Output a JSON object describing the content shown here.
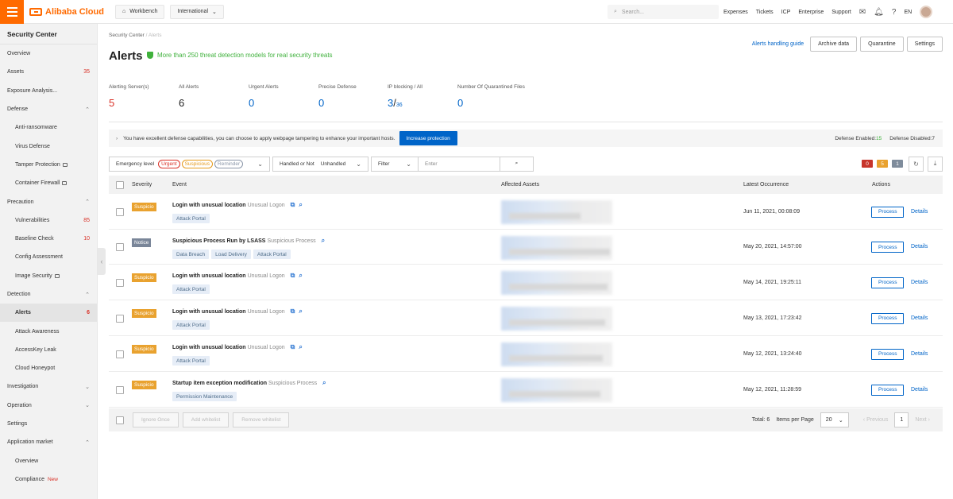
{
  "topbar": {
    "brand": "Alibaba Cloud",
    "workbench": "Workbench",
    "region": "International",
    "search_placeholder": "Search...",
    "links": [
      "Expenses",
      "Tickets",
      "ICP",
      "Enterprise",
      "Support"
    ],
    "lang": "EN"
  },
  "sidebar": {
    "title": "Security Center",
    "items": [
      {
        "label": "Overview",
        "count": "",
        "type": "top"
      },
      {
        "label": "Assets",
        "count": "35",
        "type": "top"
      },
      {
        "label": "Exposure Analysis...",
        "count": "",
        "type": "top"
      },
      {
        "label": "Defense",
        "count": "",
        "type": "group",
        "expanded": true
      },
      {
        "label": "Anti-ransomware",
        "count": "",
        "type": "sub"
      },
      {
        "label": "Virus Defense",
        "count": "",
        "type": "sub"
      },
      {
        "label": "Tamper Protection",
        "count": "",
        "type": "sub",
        "lock": true
      },
      {
        "label": "Container Firewall",
        "count": "",
        "type": "sub",
        "lock": true
      },
      {
        "label": "Precaution",
        "count": "",
        "type": "group",
        "expanded": true
      },
      {
        "label": "Vulnerabilities",
        "count": "85",
        "type": "sub"
      },
      {
        "label": "Baseline Check",
        "count": "10",
        "type": "sub"
      },
      {
        "label": "Config Assessment",
        "count": "",
        "type": "sub"
      },
      {
        "label": "Image Security",
        "count": "",
        "type": "sub",
        "lock": true
      },
      {
        "label": "Detection",
        "count": "",
        "type": "group",
        "expanded": true
      },
      {
        "label": "Alerts",
        "count": "6",
        "type": "sub",
        "active": true
      },
      {
        "label": "Attack Awareness",
        "count": "",
        "type": "sub"
      },
      {
        "label": "AccessKey Leak",
        "count": "",
        "type": "sub"
      },
      {
        "label": "Cloud Honeypot",
        "count": "",
        "type": "sub"
      },
      {
        "label": "Investigation",
        "count": "",
        "type": "group",
        "expanded": false
      },
      {
        "label": "Operation",
        "count": "",
        "type": "group",
        "expanded": false
      },
      {
        "label": "Settings",
        "count": "",
        "type": "top"
      },
      {
        "label": "Application market",
        "count": "",
        "type": "group",
        "expanded": true
      },
      {
        "label": "Overview",
        "count": "",
        "type": "sub"
      },
      {
        "label": "Compliance",
        "count": "",
        "type": "sub",
        "new": "New"
      }
    ]
  },
  "page": {
    "breadcrumb": [
      "Security Center",
      "Alerts"
    ],
    "title": "Alerts",
    "slogan": "More than 250 threat detection models for real security threats",
    "guide": "Alerts handling guide",
    "buttons": [
      "Archive data",
      "Quarantine",
      "Settings"
    ]
  },
  "stats": [
    {
      "label": "Alerting Server(s)",
      "value": "5",
      "color": "#d93026"
    },
    {
      "label": "All Alerts",
      "value": "6",
      "color": "#222222"
    },
    {
      "label": "Urgent Alerts",
      "value": "0",
      "color": "#0064c8"
    },
    {
      "label": "Precise Defense",
      "value": "0",
      "color": "#0064c8"
    },
    {
      "label": "IP blocking / All",
      "value": "3",
      "total": "36",
      "color": "#0064c8"
    },
    {
      "label": "Number Of Quarantined Files",
      "value": "0",
      "color": "#0064c8"
    }
  ],
  "notice": {
    "text": "You have excellent defense capabilities, you can choose to apply webpage tampering to enhance your important hosts.",
    "button": "Increase protection",
    "enabled_label": "Defense Enabled:",
    "enabled_value": "15",
    "disabled_label": "Defense Disabled:",
    "disabled_value": "7"
  },
  "filters": {
    "emergency_label": "Emergency level",
    "levels": [
      {
        "label": "Urgent",
        "color": "#d93026"
      },
      {
        "label": "Suspicious",
        "color": "#e59a1b"
      },
      {
        "label": "Reminder",
        "color": "#8a96a8"
      }
    ],
    "handled_label": "Handled or Not",
    "handled_value": "Unhandled",
    "filter_label": "Filter",
    "enter_placeholder": "Enter",
    "counts": [
      {
        "value": "0",
        "color": "#c7352b"
      },
      {
        "value": "5",
        "color": "#e9a22f"
      },
      {
        "value": "1",
        "color": "#7f8c9c"
      }
    ]
  },
  "table": {
    "headers": [
      "Severity",
      "Event",
      "Affected Assets",
      "Latest Occurrence",
      "Actions"
    ],
    "rows": [
      {
        "severity": "Suspicio",
        "sev_color": "#e9a22f",
        "title": "Login with unusual location",
        "subtype": "Unusual Logon",
        "icons": 2,
        "tags": [
          "Attack Portal"
        ],
        "date": "Jun 11, 2021, 00:08:09"
      },
      {
        "severity": "Notice",
        "sev_color": "#7a8699",
        "title": "Suspicious Process Run by LSASS",
        "subtype": "Suspicious Process",
        "icons": 1,
        "tags": [
          "Data Breach",
          "Load Delivery",
          "Attack Portal"
        ],
        "date": "May 20, 2021, 14:57:00"
      },
      {
        "severity": "Suspicio",
        "sev_color": "#e9a22f",
        "title": "Login with unusual location",
        "subtype": "Unusual Logon",
        "icons": 2,
        "tags": [
          "Attack Portal"
        ],
        "date": "May 14, 2021, 19:25:11"
      },
      {
        "severity": "Suspicio",
        "sev_color": "#e9a22f",
        "title": "Login with unusual location",
        "subtype": "Unusual Logon",
        "icons": 2,
        "tags": [
          "Attack Portal"
        ],
        "date": "May 13, 2021, 17:23:42"
      },
      {
        "severity": "Suspicio",
        "sev_color": "#e9a22f",
        "title": "Login with unusual location",
        "subtype": "Unusual Logon",
        "icons": 2,
        "tags": [
          "Attack Portal"
        ],
        "date": "May 12, 2021, 13:24:40"
      },
      {
        "severity": "Suspicio",
        "sev_color": "#e9a22f",
        "title": "Startup item exception modification",
        "subtype": "Suspicious Process",
        "icons": 1,
        "tags": [
          "Permission Maintenance"
        ],
        "date": "May 12, 2021, 11:28:59"
      }
    ],
    "process_label": "Process",
    "details_label": "Details"
  },
  "footer": {
    "buttons": [
      "Ignore Once",
      "Add whitelist",
      "Remove whitelist"
    ],
    "total": "Total: 6",
    "per_page_label": "Items per Page",
    "per_page": "20",
    "prev": "Previous",
    "page": "1",
    "next": "Next"
  }
}
